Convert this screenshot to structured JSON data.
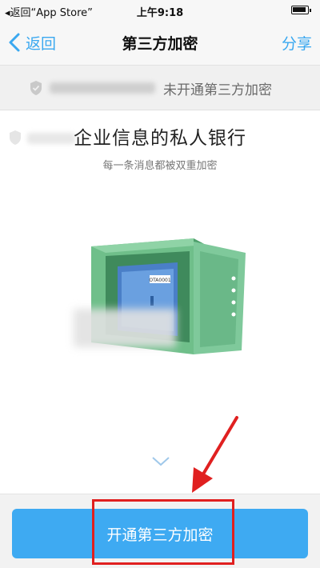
{
  "status_bar": {
    "back_app": "◂返回“App Store”",
    "time": "上午9:18"
  },
  "nav": {
    "back_label": "返回",
    "title": "第三方加密",
    "share_label": "分享"
  },
  "account_row": {
    "status": "未开通第三方加密"
  },
  "intro": {
    "title": "企业信息的私人银行",
    "subtitle": "每一条消息都被双重加密"
  },
  "safe": {
    "tag_text": "OTA0001"
  },
  "action": {
    "enable_label": "开通第三方加密"
  },
  "colors": {
    "accent": "#3aa8f0",
    "button": "#3eaaf2",
    "annotation_red": "#e02020",
    "safe_green": "#6fbf8a"
  }
}
